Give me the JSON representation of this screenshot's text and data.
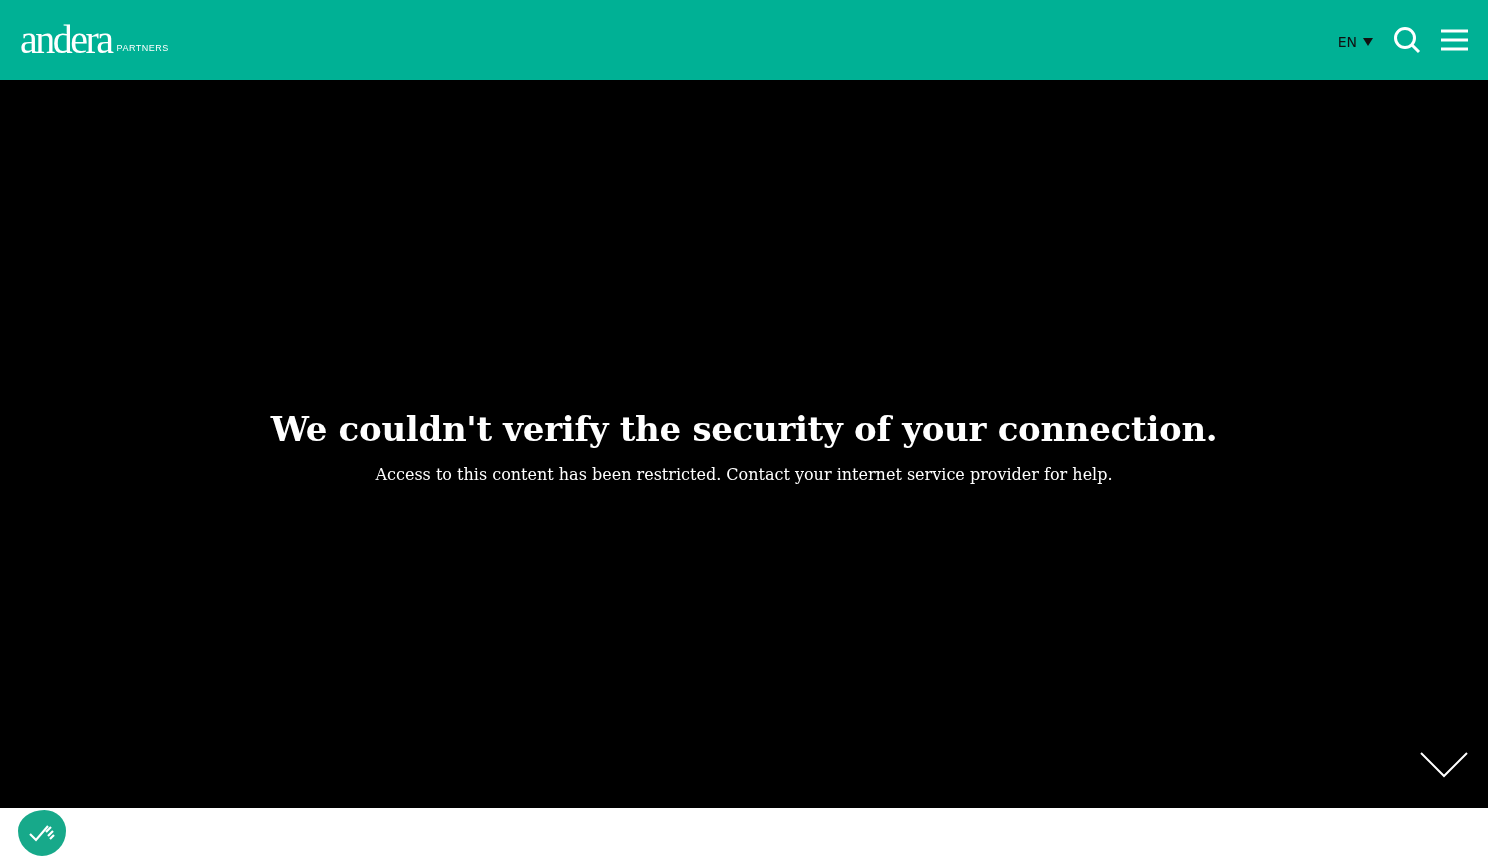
{
  "header": {
    "logo": {
      "wordmark": "andera",
      "tagline": "PARTNERS"
    },
    "language": "EN"
  },
  "hero": {
    "title": "We couldn't verify the security of your connection.",
    "message": "Access to this content has been restricted. Contact your internet service provider for help."
  }
}
